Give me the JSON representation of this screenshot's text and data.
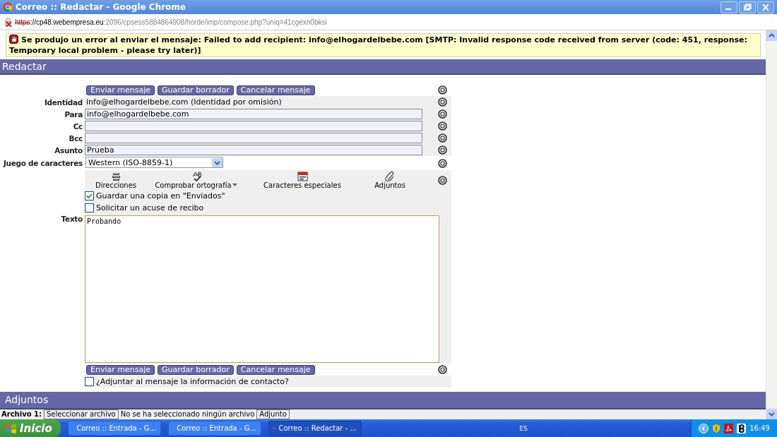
{
  "window": {
    "title": "Correo :: Redactar - Google Chrome"
  },
  "address_bar": {
    "scheme": "https",
    "host": "://cp48.webempresa.eu",
    "path": ":2096/cpsess5884864908/horde/imp/compose.php?uniq=41cgexn0bksi"
  },
  "error_message": "Se produjo un error al enviar el mensaje: Failed to add recipient: info@elhogardelbebe.com [SMTP: Invalid response code received from server (code: 451, response: Temporary local problem - please try later)]",
  "compose": {
    "title": "Redactar",
    "buttons": [
      "Enviar mensaje",
      "Guardar borrador",
      "Cancelar mensaje"
    ],
    "fields": [
      {
        "kind": "text",
        "label": "Identidad",
        "value": "info@elhogardelbebe.com (Identidad por omisión)"
      },
      {
        "kind": "input",
        "label": "Para",
        "value": "info@elhogardelbebe.com"
      },
      {
        "kind": "input",
        "label": "Cc"
      },
      {
        "kind": "input",
        "label": "Bcc"
      },
      {
        "kind": "input",
        "label": "Asunto",
        "value": "Prueba"
      },
      {
        "kind": "select",
        "label": "Juego de caracteres",
        "value": "Western (ISO-8859-1)"
      }
    ],
    "tools": [
      {
        "kind": "addressbook",
        "label": "Direcciones",
        "dropdown": false
      },
      {
        "kind": "spellcheck",
        "label": "Comprobar ortografía",
        "dropdown": true
      },
      {
        "kind": "charmap",
        "label": "Caracteres especiales",
        "dropdown": false
      },
      {
        "kind": "attach",
        "label": "Adjuntos",
        "dropdown": false
      }
    ],
    "options": [
      {
        "label": "Guardar una copia en \"Enviados\"",
        "checked": true
      },
      {
        "label": "Solicitar un acuse de recibo",
        "checked": false
      }
    ],
    "body": {
      "label": "Texto",
      "value": "Probando"
    },
    "bottom_buttons": [
      "Enviar mensaje",
      "Guardar borrador",
      "Cancelar mensaje"
    ],
    "contact_option": {
      "label": "¿Adjuntar al mensaje la información de contacto?",
      "checked": false
    }
  },
  "attachments": {
    "title": "Adjuntos",
    "file_label": "Archivo 1:",
    "file_button": "Seleccionar archivo",
    "file_status": "No se ha seleccionado ningún archivo",
    "disposition": "Adjunto"
  },
  "taskbar": {
    "start": "Inicio",
    "tasks": [
      {
        "label": "Correo :: Entrada - G...",
        "selected": false
      },
      {
        "label": "Correo :: Entrada - G...",
        "selected": false
      },
      {
        "label": "Correo :: Redactar - ...",
        "selected": true
      }
    ],
    "language": "ES",
    "clock": "16:49"
  }
}
